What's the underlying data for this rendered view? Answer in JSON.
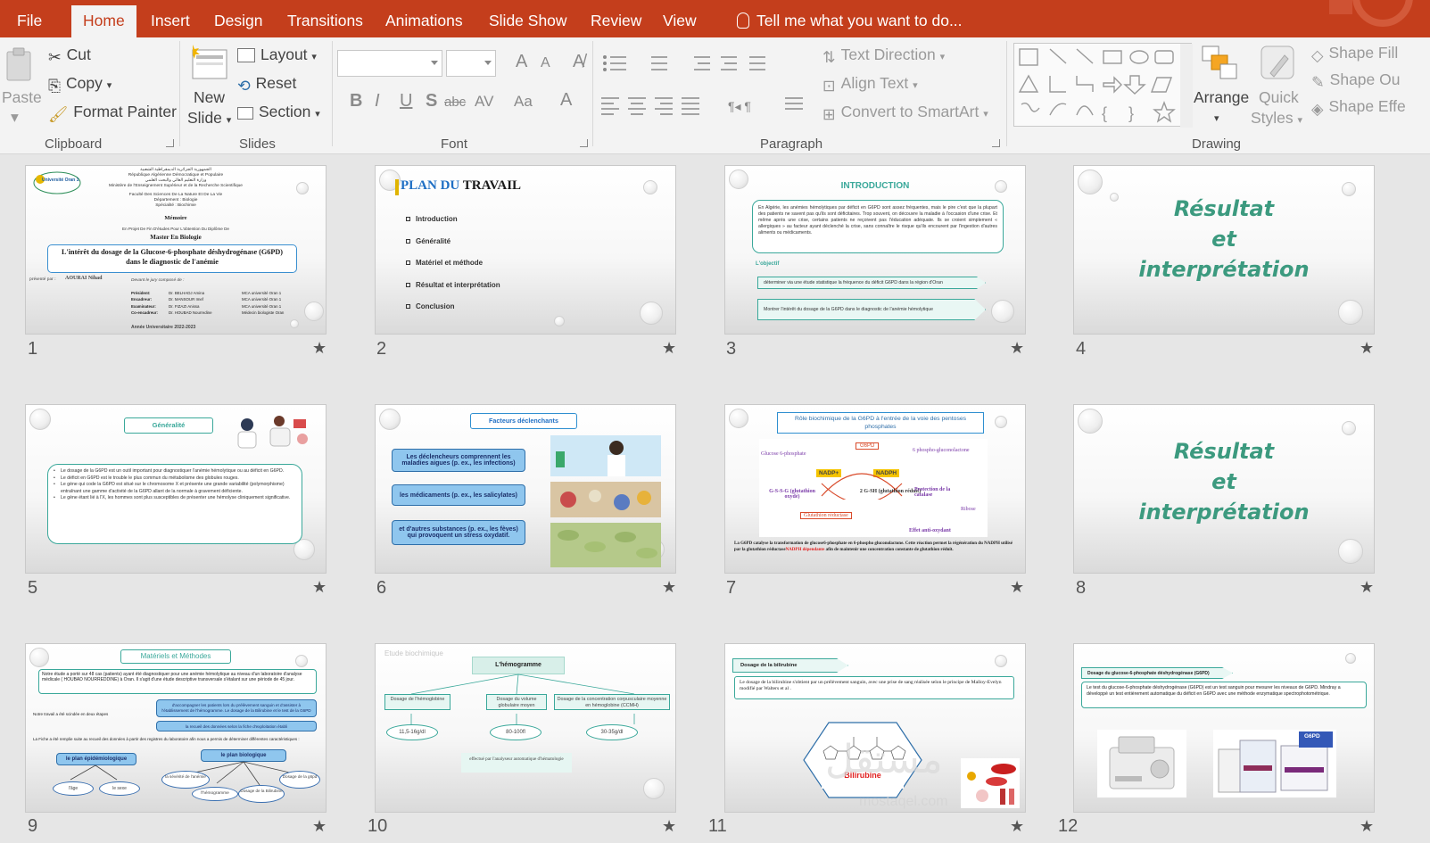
{
  "tabs": [
    {
      "label": "File",
      "active": false
    },
    {
      "label": "Home",
      "active": true
    },
    {
      "label": "Insert",
      "active": false
    },
    {
      "label": "Design",
      "active": false
    },
    {
      "label": "Transitions",
      "active": false
    },
    {
      "label": "Animations",
      "active": false
    },
    {
      "label": "Slide Show",
      "active": false
    },
    {
      "label": "Review",
      "active": false
    },
    {
      "label": "View",
      "active": false
    }
  ],
  "tell_me": "Tell me what you want to do...",
  "ribbon": {
    "clipboard": {
      "paste": "Paste",
      "cut": "Cut",
      "copy": "Copy",
      "format_painter": "Format Painter",
      "label": "Clipboard"
    },
    "slides": {
      "new_slide_1": "New",
      "new_slide_2": "Slide",
      "layout": "Layout",
      "reset": "Reset",
      "section": "Section",
      "label": "Slides"
    },
    "font": {
      "bold": "B",
      "italic": "I",
      "underline": "U",
      "shadow": "S",
      "strike": "abc",
      "spacing": "AV",
      "case": "Aa",
      "grow": "A",
      "shrink": "A",
      "color": "A",
      "label": "Font"
    },
    "paragraph": {
      "text_direction": "Text Direction",
      "align_text": "Align Text",
      "convert_smartart": "Convert to SmartArt",
      "label": "Paragraph"
    },
    "drawing": {
      "arrange": "Arrange",
      "quick_styles_1": "Quick",
      "quick_styles_2": "Styles",
      "shape_fill": "Shape Fill",
      "shape_outline": "Shape Ou",
      "shape_effects": "Shape Effe",
      "label": "Drawing"
    }
  },
  "colors": {
    "accent": "#c43e1c",
    "teal": "#3c9a7f",
    "ribbon_bg": "#f3f3f3",
    "sorter_bg": "#e6e6e6"
  },
  "slides": [
    {
      "number": "1",
      "uni": "Université Oran 1",
      "lines": [
        "الجمهورية الجزائرية الديمقراطية الشعبية",
        "République Algérienne Démocratique et Populaire",
        "وزارة التعليم العالي والبحث العلمي",
        "Ministère de l'Enseignement Supérieur et de la Recherche Scientifique",
        "Faculté Des Sciences De La Nature Et De La Vie",
        "Département : Biologie",
        "Spécialité : Biochimie"
      ],
      "memoire": "Mémoire",
      "projet": "En Projet De Fin D'études Pour L'obtention Du Diplôme De",
      "master": "Master En Biologie",
      "title": "L'intérêt du dosage de la  Glucose-6-phosphate déshydrogénase (G6PD) dans le diagnostic de l'anémie",
      "presente": "présenté par :",
      "author": "AOURAI Nihad",
      "jury": "Devant le jury composé de :",
      "jury_rows": [
        [
          "Président:",
          "Dr. BELHADJ Amina",
          "MCA université Oran 1"
        ],
        [
          "Encadreur:",
          "Dr. MANSOUR Imef",
          "MCA université Oran 1"
        ],
        [
          "Examinateur:",
          "Dr. FIZAZI Anissa",
          "MCA université Oran 1"
        ],
        [
          "Co-encadreur:",
          "Dr. HOUBAD Nourredine",
          "Médecin biologiste Oran"
        ]
      ],
      "year": "Année Universitaire 2022-2023"
    },
    {
      "number": "2",
      "title_part1": "PLAN DU ",
      "title_part2": "TRAVAIL",
      "items": [
        "Introduction",
        "Généralité",
        "Matériel et méthode",
        "Résultat et interprétation",
        "Conclusion"
      ]
    },
    {
      "number": "3",
      "title": "INTRODUCTION",
      "intro": "En Algérie, les anémies hémolytiques par déficit en G6PD sont assez fréquentes, mais le pire c'est que la plupart des patients ne savent pas qu'ils sont déficitaires. Trop souvent, on découvre la maladie à l'occasion d'une crise. Et même après une crise, certains patients ne reçoivent pas l'éducation adéquate. Ils se croient simplement « allergiques » au facteur ayant déclenché la crise, sans connaître le risque qu'ils encourent par l'ingestion d'autres aliments ou médicaments.",
      "objectif": "L'objectif",
      "obj1": "déterminer via une étude statistique la fréquence du déficit G6PD dans la région d'Oran",
      "obj2": "Montrer l'intérêt du dosage de la G6PD dans le diagnostic de l'anémie hémolytique"
    },
    {
      "number": "4",
      "lines": [
        "Résultat",
        "et",
        "interprétation"
      ]
    },
    {
      "number": "5",
      "title": "Généralité",
      "bullets": [
        "Le dosage de la G6PD est un outil important pour diagnostiquer l'anémie hémolytique ou au déficit en G6PD.",
        "Le déficit en G6PD est le trouble le plus commun du métabolisme des globules rouges.",
        "Le gène qui code la G6PD est situé sur le chromosome X et présente une grande variabilité (polymorphisme) entraînant une gamme d'activité de la G6PD allant de la normale à gravement déficiente.",
        "Le gène étant lié à l'X, les hommes sont plus susceptibles de présenter une hémolyse cliniquement significative."
      ]
    },
    {
      "number": "6",
      "title": "Facteurs déclenchants",
      "boxes": [
        "Les déclencheurs comprennent les maladies aigues (p. ex., les infections)",
        "les médicaments (p. ex., les salicylates)",
        "et d'autres substances (p. ex., les fèves) qui provoquent un stress oxydatif."
      ]
    },
    {
      "number": "7",
      "title": "Rôle biochimique de la G6PD à l'entrée de la voie des pentoses phosphates",
      "diagram": {
        "g6pd": "G6PD",
        "gluc": "Glucose 6-phosphate",
        "pglu": "6 phospho-gluconolactone",
        "nadp": "NADP+",
        "nadph": "NADPH",
        "gssg": "G-S-S-G (glutathion oxydé)",
        "gsh": "2 G-SH (glutathion réduit)",
        "protect": "Protection de la catalase",
        "red": "Glutathion réductase",
        "ribose": "Ribose",
        "effet": "Effet anti-oxydant"
      },
      "caption_a": "La G6PD catalyse la transformation de glucose6-phosphate en 6-phospho gluconolactone. Cette réaction permet la régénération du NADPH utilisé par la glutathion réductase",
      "caption_red": "NADPH dépendante",
      "caption_b": " afin de maintenir une concentration constante de glutathion réduit."
    },
    {
      "number": "8",
      "lines": [
        "Résultat",
        "et",
        "interprétation"
      ]
    },
    {
      "number": "9",
      "title": "Matériels et Méthodes",
      "para": "Notre étude a porté sur 48 cas (patients) ayant été diagnostiquer pour une anémie hémolytique au niveau d'un laboratoire d'analyse médicale ( HOUBAD NOURREDDINE) à Oran. Il s'agit d'une étude descriptive transversale s'étalant sur une période de 45 jour.",
      "b1": "Notre travail a été scindée en deux étapes",
      "box1": "d'accompagner les patients lors du prélèvement sanguin et d'assister à l'établissement de l'hémogramme. Le dosage de la Bilirubine et le test de la G6PD",
      "box2": "la recueil des données selon la fiche d'exploitation établi",
      "b2": "La Fiche a été remplie suite au recueil des données à partir des registres du laboratoire afin nous a permis de déterminer différentes caractéristiques :",
      "epi": "le plan épidémiologique",
      "bio": "le plan biologique",
      "age": "l'âge",
      "sexe": "le sexe",
      "sev": "la sévérité de l'anémie",
      "hemo": "l'hémogramme",
      "bili": "Dosage de la Bilirubine",
      "g6pd": "Dosage de la g6pd"
    },
    {
      "number": "10",
      "faded": "Etude biochimique",
      "title": "L'hémogramme",
      "c1": "Dosage de l'hémoglobine",
      "c2": "Dosage du volume globulaire moyen",
      "c3": "Dosage de la concentration corpusculaire moyenne en hémoglobine (CCMH)",
      "v1": "11,5-16g/dl",
      "v2": "80-100fl",
      "v3": "30-35g/dl",
      "note": "effectué par l'analyseur automatique d'hématologie"
    },
    {
      "number": "11",
      "tag": "Dosage de la bilirubine",
      "text": "Le dosage de la bilirubine s'obtient par un prélèvement sanguin, avec une prise de sang réalisée selon le principe de Malloy-Evelyn modifié par Walters et al .",
      "mol": "Bilirubine",
      "watermark": "مستقل",
      "watermark_sub": "mostaqel.com"
    },
    {
      "number": "12",
      "tag": "Dosage du glucose-6-phosphate déshydrogénase (G6PD)",
      "text": "Le test du glucose-6-phosphate déshydrogénase (G6PD) est un test sanguin pour mesurer les niveaux de G6PD. Mindray a développé un test entièrement automatique du déficit en G6PD avec une méthode enzymatique spectrophotométrique.",
      "kit": "G6PD"
    }
  ]
}
